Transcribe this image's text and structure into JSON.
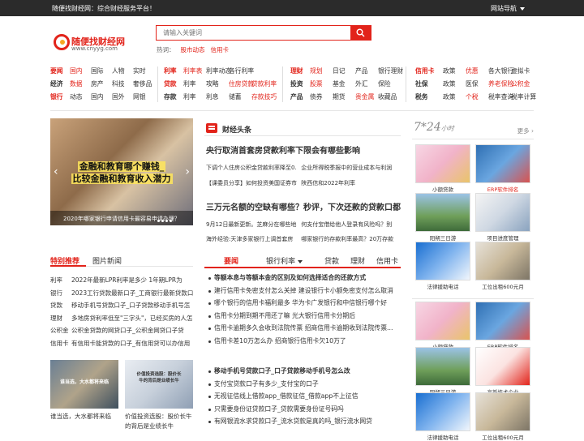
{
  "topbar": {
    "welcome": "随便找财经网：综合财经服务平台！",
    "nav": "网站导航"
  },
  "logo": {
    "name": "随便找财经网",
    "url": "www.cnyyg.com"
  },
  "search": {
    "placeholder": "请输入关键词"
  },
  "hot": {
    "label": "热词：",
    "words": [
      "股市动态",
      "信用卡"
    ]
  },
  "navgroups": [
    {
      "rows": [
        [
          {
            "t": "要闻",
            "r": true,
            "b": true
          },
          {
            "t": "国内",
            "r": true
          },
          {
            "t": "国际"
          },
          {
            "t": "人物"
          },
          {
            "t": "实时"
          }
        ],
        [
          {
            "t": "经济",
            "b": true
          },
          {
            "t": "数据",
            "r": true
          },
          {
            "t": "房产"
          },
          {
            "t": "科技"
          },
          {
            "t": "奢侈品"
          }
        ],
        [
          {
            "t": "银行",
            "r": true,
            "b": true
          },
          {
            "t": "动态"
          },
          {
            "t": "国内"
          },
          {
            "t": "国外"
          },
          {
            "t": "网银"
          }
        ]
      ]
    },
    {
      "rows": [
        [
          {
            "t": "利率",
            "r": true,
            "b": true
          },
          {
            "t": "利率表",
            "r": true
          },
          {
            "t": "利率动态"
          },
          {
            "t": "各行利率"
          }
        ],
        [
          {
            "t": "贷款",
            "r": true,
            "b": true
          },
          {
            "t": "利率"
          },
          {
            "t": "攻略"
          },
          {
            "t": "住房贷款",
            "r": true
          },
          {
            "t": "贷款利率",
            "r": true
          }
        ],
        [
          {
            "t": "存款",
            "b": true
          },
          {
            "t": "利率"
          },
          {
            "t": "利息"
          },
          {
            "t": "储蓄"
          },
          {
            "t": "存款技巧",
            "r": true
          }
        ]
      ]
    },
    {
      "rows": [
        [
          {
            "t": "理财",
            "r": true,
            "b": true
          },
          {
            "t": "规划",
            "r": true
          },
          {
            "t": "日记"
          },
          {
            "t": "产品"
          },
          {
            "t": "银行理财"
          }
        ],
        [
          {
            "t": "投资",
            "b": true
          },
          {
            "t": "股票",
            "r": true
          },
          {
            "t": "基金"
          },
          {
            "t": "外汇"
          },
          {
            "t": "保险"
          }
        ],
        [
          {
            "t": "产品",
            "b": true
          },
          {
            "t": "债券"
          },
          {
            "t": "期货"
          },
          {
            "t": "贵金属",
            "r": true
          },
          {
            "t": "收藏品"
          }
        ]
      ]
    },
    {
      "rows": [
        [
          {
            "t": "信用卡",
            "r": true,
            "b": true
          },
          {
            "t": "政策"
          },
          {
            "t": "优惠",
            "r": true
          },
          {
            "t": "各大银行"
          },
          {
            "t": "虚拟卡"
          }
        ],
        [
          {
            "t": "社保",
            "b": true
          },
          {
            "t": "政策"
          },
          {
            "t": "医保"
          },
          {
            "t": "养老保险",
            "r": true
          },
          {
            "t": "公积金",
            "r": true
          }
        ],
        [
          {
            "t": "税务",
            "b": true
          },
          {
            "t": "政策"
          },
          {
            "t": "个税",
            "r": true
          },
          {
            "t": "税率查询"
          },
          {
            "t": "税率计算"
          }
        ]
      ]
    }
  ],
  "slider": {
    "line1": "金融和教育哪个赚钱_",
    "line2": "比较金融和教育收入潜力",
    "caption": "2020年哪家银行申请信用卡最容易申请办理？"
  },
  "leftTabs": [
    "特别推荐",
    "图片新闻"
  ],
  "recommend": [
    {
      "c": "利率",
      "t": "2022年最新LPR利率是多少 1年期LPR为"
    },
    {
      "c": "银行",
      "t": "2023工行贷款最新口子_工商银行最新贷款口"
    },
    {
      "c": "贷款",
      "t": "移动手机号贷款口子_口子贷款移动手机号怎"
    },
    {
      "c": "理财",
      "t": "多地房贷利率低至\"三字头\"，已经买房的人怎"
    },
    {
      "c": "公积金",
      "t": "公积金贷款的网贷口子_公积金网贷口子贷"
    },
    {
      "c": "信用卡",
      "t": "有信用卡能贷款的口子_有信用贷可以办信用"
    }
  ],
  "pics": [
    {
      "t": "谁当选，大水都将来临",
      "overlay": "谁当选，大水都将来临"
    },
    {
      "t": "价值投资选股：股价长牛的背后是业绩长牛",
      "overlay": "价值投资选股：股价长牛的背后是业绩长牛"
    }
  ],
  "headlines": {
    "title": "财经头条",
    "items": [
      {
        "big": "央行取消首套房贷款利率下限会有哪些影响",
        "subs": [
          "下调个人住房公积金贷款利率降至0.",
          "企业所得税季报中的营业成本与利润"
        ],
        "subs2": [
          "【课委员分享】如何投资美国证券市",
          "陕西信和2022年利率"
        ]
      },
      {
        "big": "三万元名额的空缺有哪些？秒评，下次还款的贷款口都",
        "subs": [
          "9月12日最新更新。芝麻分在哪些地",
          "何支付宝借给他人登录有风险吗？别"
        ],
        "subs2": [
          "海外经验:天津多家银行上调首套房",
          "哪家银行的存款利率最高？20万存款"
        ]
      }
    ]
  },
  "midTabs": [
    "要闻",
    "银行利率",
    "贷款",
    "理财",
    "信用卡"
  ],
  "news1": [
    {
      "t": "等额本息与等额本金的区别及如何选择适合的还款方式",
      "b": true
    },
    {
      "t": "建行信用卡免密支付怎么关掉 建设银行卡小额免密支付怎么取消"
    },
    {
      "t": "哪个银行的信用卡福利最多 华为卡广发银行和中信银行哪个好"
    },
    {
      "t": "信用卡分期到期不用还了嘛 光大银行信用卡分期后"
    },
    {
      "t": "信用卡逾期多久会收到法院传票 招商信用卡逾期收到法院传票..."
    },
    {
      "t": "信用卡差10万怎么办 招商银行信用卡欠10万了"
    }
  ],
  "news2": [
    {
      "t": "移动手机号贷款口子_口子贷款移动手机号怎么改",
      "b": true
    },
    {
      "t": "支付宝贷款口子有多少_支付宝的口子"
    },
    {
      "t": "无视征信线上借款app_借款征信_借款app不上征信"
    },
    {
      "t": "只需要身份证贷款口子_贷款需要身份证号码吗"
    },
    {
      "t": "有网银流水求贷款口子_流水贷款是真的吗_银行流水网贷"
    }
  ],
  "side": {
    "title": "7*24",
    "titleSmall": "小时",
    "more": "更多 ›"
  },
  "grid1": [
    {
      "t": "小额贷款"
    },
    {
      "t": "ERP软件排名",
      "r": true
    },
    {
      "t": "阳朔三日游"
    },
    {
      "t": "项目进度管理"
    },
    {
      "t": "法律援助电话"
    },
    {
      "t": "工位出租600元月"
    }
  ],
  "grid2": [
    {
      "t": "小额贷款"
    },
    {
      "t": "ERP软件排名"
    },
    {
      "t": "阳朔三日游"
    },
    {
      "t": "高新技术企业"
    },
    {
      "t": "法律援助电话"
    },
    {
      "t": "工位出租600元月"
    }
  ]
}
